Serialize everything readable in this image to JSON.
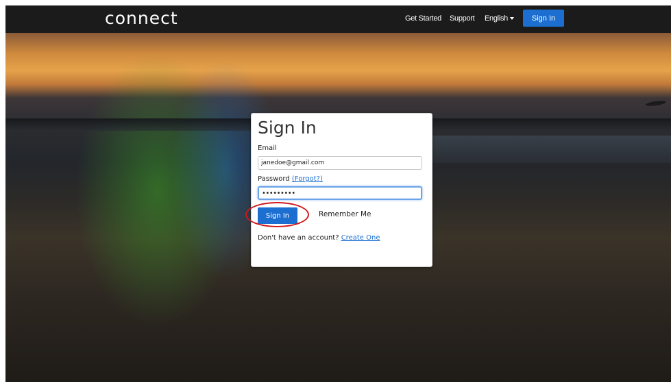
{
  "header": {
    "logo": "connect",
    "nav": {
      "get_started": "Get Started",
      "support": "Support",
      "language": "English"
    },
    "signin_button": "Sign In"
  },
  "login_form": {
    "title": "Sign In",
    "email_label": "Email",
    "email_value": "janedoe@gmail.com",
    "password_label": "Password",
    "forgot_link": "(Forgot?)",
    "password_value": "•••••••••",
    "submit_label": "Sign In",
    "remember_label": "Remember Me",
    "no_account_text": "Don't have an account?",
    "create_link": "Create One"
  },
  "colors": {
    "accent": "#1c6fd1",
    "highlight_circle": "#d0181c",
    "topbar": "#1b1b1b"
  },
  "icons": {
    "language_dropdown": "caret-down-icon"
  }
}
